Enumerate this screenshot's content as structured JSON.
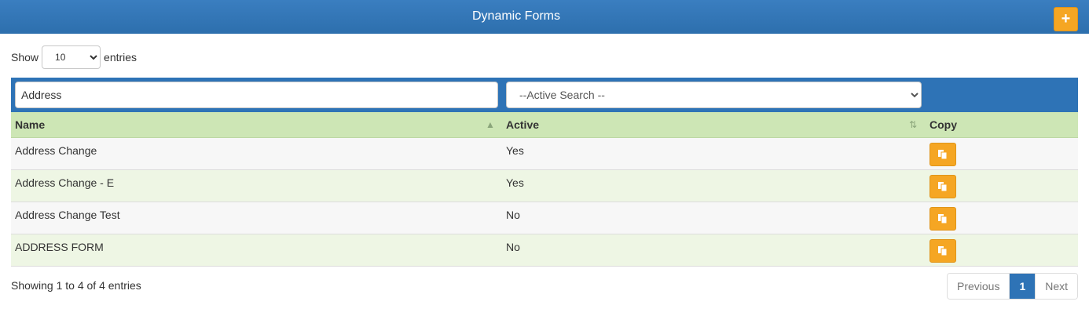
{
  "header": {
    "title": "Dynamic Forms",
    "add_label": "+"
  },
  "length": {
    "show_label": "Show",
    "selected": "10",
    "entries_label": "entries"
  },
  "filters": {
    "name_value": "Address",
    "active_placeholder": "--Active Search --"
  },
  "columns": {
    "name": "Name",
    "active": "Active",
    "copy": "Copy"
  },
  "rows": [
    {
      "name": "Address Change",
      "active": "Yes"
    },
    {
      "name": "Address Change - E",
      "active": "Yes"
    },
    {
      "name": "Address Change Test",
      "active": "No"
    },
    {
      "name": "ADDRESS FORM",
      "active": "No"
    }
  ],
  "footer": {
    "info": "Showing 1 to 4 of 4 entries"
  },
  "pagination": {
    "previous": "Previous",
    "current": "1",
    "next": "Next"
  },
  "colors": {
    "topbar": "#2e73b6",
    "accent": "#f5a623",
    "header_row": "#cde6b5",
    "even_row": "#eef6e4"
  }
}
